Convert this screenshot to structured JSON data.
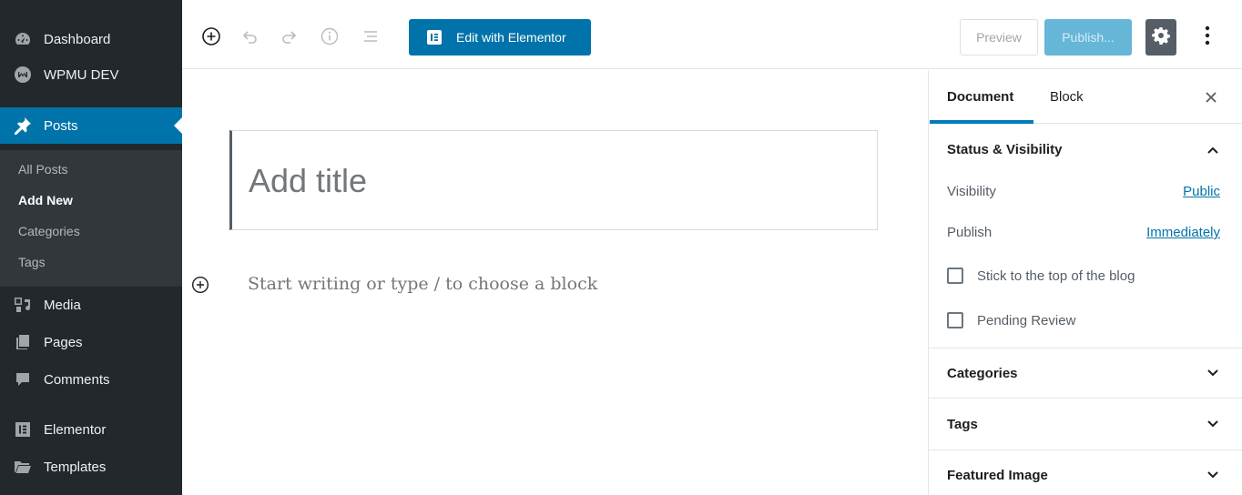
{
  "admin_menu": {
    "items": [
      {
        "label": "Dashboard",
        "icon": "dashboard-icon"
      },
      {
        "label": "WPMU DEV",
        "icon": "wpmudev-icon"
      },
      {
        "label": "Posts",
        "icon": "pin-icon",
        "active": true
      },
      {
        "label": "Media",
        "icon": "media-icon"
      },
      {
        "label": "Pages",
        "icon": "pages-icon"
      },
      {
        "label": "Comments",
        "icon": "comments-icon"
      },
      {
        "label": "Elementor",
        "icon": "elementor-icon"
      },
      {
        "label": "Templates",
        "icon": "folder-icon"
      }
    ],
    "posts_submenu": [
      {
        "label": "All Posts"
      },
      {
        "label": "Add New",
        "current": true
      },
      {
        "label": "Categories"
      },
      {
        "label": "Tags"
      }
    ]
  },
  "toolbar": {
    "icons": [
      "add-block-icon",
      "undo-icon",
      "redo-icon",
      "info-icon",
      "outline-icon"
    ],
    "elementor_label": "Edit with Elementor",
    "preview_label": "Preview",
    "publish_label": "Publish...",
    "settings_icon": "gear-icon",
    "more_icon": "more-vertical-icon"
  },
  "editor": {
    "title_placeholder": "Add title",
    "block_placeholder": "Start writing or type / to choose a block"
  },
  "settings_sidebar": {
    "tabs": [
      {
        "label": "Document",
        "active": true
      },
      {
        "label": "Block"
      }
    ],
    "status_panel": {
      "title": "Status & Visibility",
      "visibility_label": "Visibility",
      "visibility_value": "Public",
      "publish_label": "Publish",
      "publish_value": "Immediately",
      "sticky_label": "Stick to the top of the blog",
      "sticky_checked": false,
      "pending_label": "Pending Review",
      "pending_checked": false
    },
    "panels": [
      {
        "title": "Categories"
      },
      {
        "title": "Tags"
      },
      {
        "title": "Featured Image"
      }
    ]
  },
  "colors": {
    "admin_bg": "#23282d",
    "submenu_bg": "#32373c",
    "accent": "#0073aa",
    "publish_disabled": "#66b6d8",
    "settings_active": "#555d66"
  }
}
